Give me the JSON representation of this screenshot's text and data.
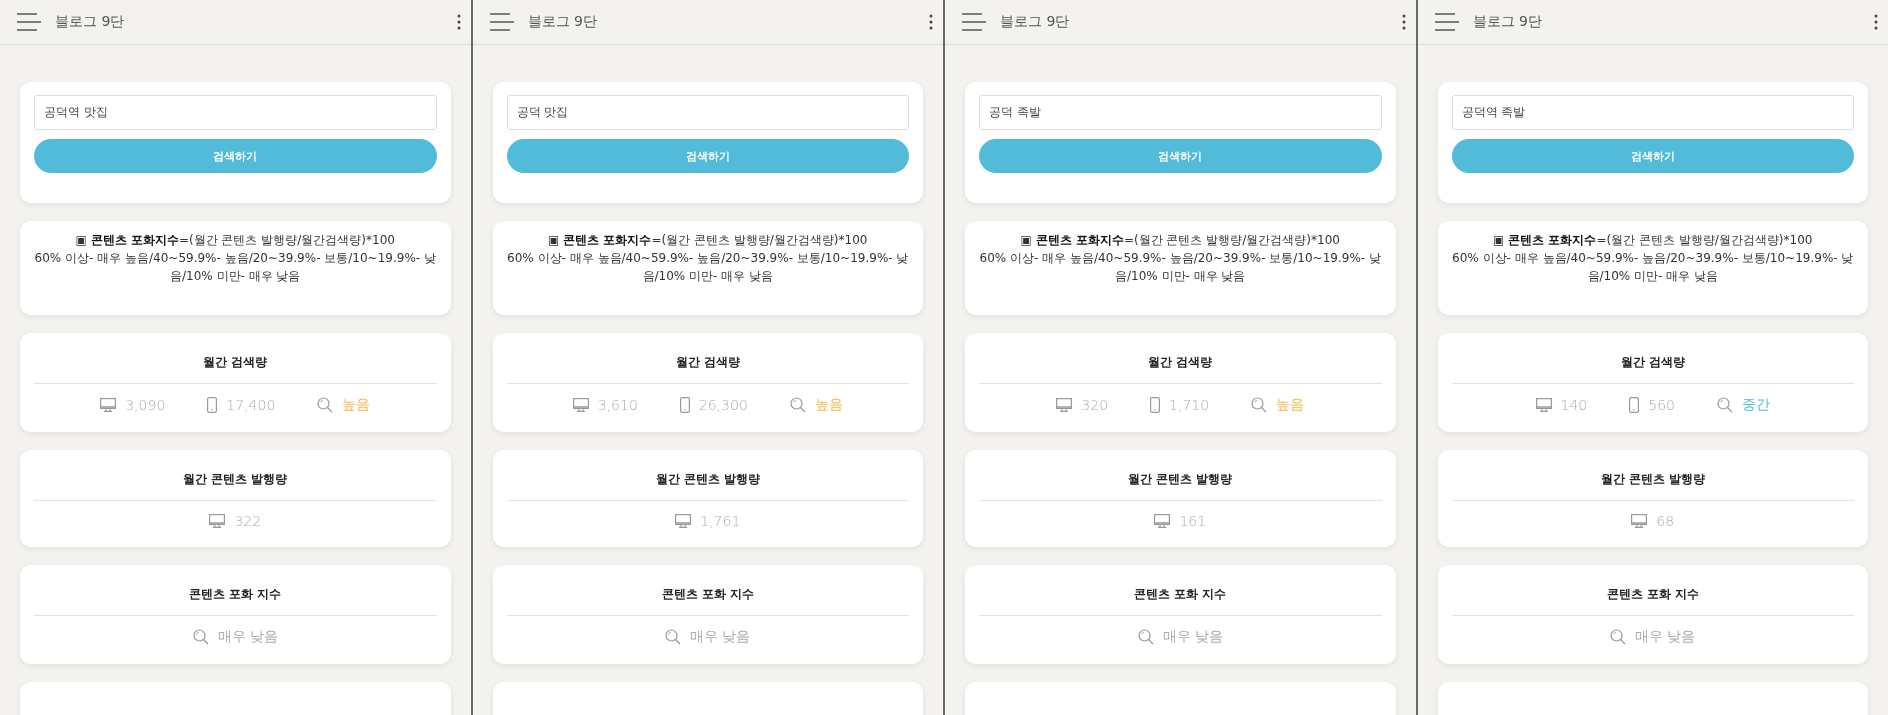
{
  "panels": [
    {
      "app_title": "블로그 9단",
      "search": {
        "value": "공덕역 맛집",
        "button": "검색하기"
      },
      "note": {
        "formula": "▣ **콘텐츠 포화지수**=(월간 콘텐츠 발행량/월간검색량)*100",
        "scale": "60% 이상- 매우 높음/40~59.9%- 높음/20~39.9%- 보통/10~19.9%- 낮음/10% 미만- 매우 낮음"
      },
      "monthly_search": {
        "title": "월간 검색량",
        "pc": "3,090",
        "mobile": "17,400",
        "rating": {
          "text": "높음",
          "color": "#f7b84b"
        }
      },
      "monthly_content": {
        "title": "월간 콘텐츠 발행량",
        "count": "322"
      },
      "saturation": {
        "title": "콘텐츠 포화 지수",
        "value": "매우 낮음"
      }
    },
    {
      "app_title": "블로그 9단",
      "search": {
        "value": "공덕 맛집",
        "button": "검색하기"
      },
      "note": {
        "formula": "▣ **콘텐츠 포화지수**=(월간 콘텐츠 발행량/월간검색량)*100",
        "scale": "60% 이상- 매우 높음/40~59.9%- 높음/20~39.9%- 보통/10~19.9%- 낮음/10% 미만- 매우 낮음"
      },
      "monthly_search": {
        "title": "월간 검색량",
        "pc": "3,610",
        "mobile": "26,300",
        "rating": {
          "text": "높음",
          "color": "#f7b84b"
        }
      },
      "monthly_content": {
        "title": "월간 콘텐츠 발행량",
        "count": "1,761"
      },
      "saturation": {
        "title": "콘텐츠 포화 지수",
        "value": "매우 낮음"
      }
    },
    {
      "app_title": "블로그 9단",
      "search": {
        "value": "공덕 족발",
        "button": "검색하기"
      },
      "note": {
        "formula": "▣ **콘텐츠 포화지수**=(월간 콘텐츠 발행량/월간검색량)*100",
        "scale": "60% 이상- 매우 높음/40~59.9%- 높음/20~39.9%- 보통/10~19.9%- 낮음/10% 미만- 매우 낮음"
      },
      "monthly_search": {
        "title": "월간 검색량",
        "pc": "320",
        "mobile": "1,710",
        "rating": {
          "text": "높음",
          "color": "#f7b84b"
        }
      },
      "monthly_content": {
        "title": "월간 콘텐츠 발행량",
        "count": "161"
      },
      "saturation": {
        "title": "콘텐츠 포화 지수",
        "value": "매우 낮음"
      }
    },
    {
      "app_title": "블로그 9단",
      "search": {
        "value": "공덕역 족발",
        "button": "검색하기"
      },
      "note": {
        "formula": "▣ **콘텐츠 포화지수**=(월간 콘텐츠 발행량/월간검색량)*100",
        "scale": "60% 이상- 매우 높음/40~59.9%- 높음/20~39.9%- 보통/10~19.9%- 낮음/10% 미만- 매우 낮음"
      },
      "monthly_search": {
        "title": "월간 검색량",
        "pc": "140",
        "mobile": "560",
        "rating": {
          "text": "중간",
          "color": "#4fbcd9"
        }
      },
      "monthly_content": {
        "title": "월간 콘텐츠 발행량",
        "count": "68"
      },
      "saturation": {
        "title": "콘텐츠 포화 지수",
        "value": "매우 낮음"
      }
    }
  ]
}
